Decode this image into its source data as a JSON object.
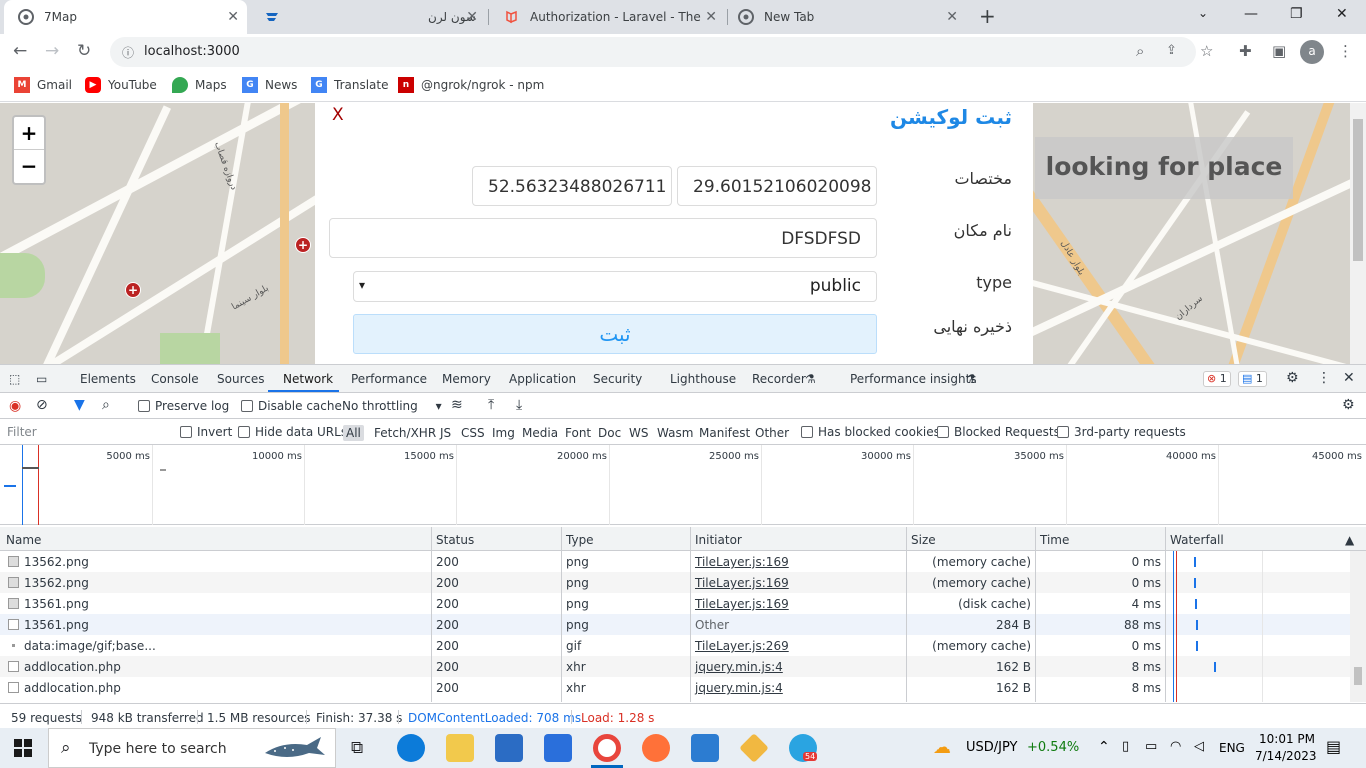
{
  "browser": {
    "tabs": [
      {
        "title": "7Map",
        "active": true
      },
      {
        "title": "سون لرن",
        "active": false
      },
      {
        "title": "Authorization - Laravel - The PHP",
        "active": false
      },
      {
        "title": "New Tab",
        "active": false
      }
    ],
    "url": "localhost:3000",
    "avatar_letter": "a",
    "bookmarks": [
      {
        "label": "Gmail",
        "color": "#ea4335",
        "icon": "gmail-icon"
      },
      {
        "label": "YouTube",
        "color": "#ff0000",
        "icon": "youtube-icon"
      },
      {
        "label": "Maps",
        "color": "#34a853",
        "icon": "maps-icon"
      },
      {
        "label": "News",
        "color": "#4285f4",
        "icon": "news-icon"
      },
      {
        "label": "Translate",
        "color": "#4285f4",
        "icon": "translate-icon"
      },
      {
        "label": "@ngrok/ngrok - npm",
        "color": "#cb0000",
        "icon": "npm-icon"
      }
    ]
  },
  "page": {
    "modal": {
      "close": "X",
      "title": "ثبت لوکیشن",
      "coords_label": "مختصات",
      "lat": "29.60152106020098",
      "lng": "52.56323488026711",
      "name_label": "نام مکان",
      "name_value": "DFSDFSD",
      "type_label": "type",
      "type_value": "public",
      "save_label": "ذخیره نهایی",
      "submit": "ثبت"
    },
    "search_overlay": "looking for place",
    "zoom_in": "+",
    "zoom_out": "−"
  },
  "devtools": {
    "tabs": [
      "Elements",
      "Console",
      "Sources",
      "Network",
      "Performance",
      "Memory",
      "Application",
      "Security",
      "Lighthouse",
      "Recorder",
      "Performance insights"
    ],
    "active_tab": "Network",
    "error_count": "1",
    "message_count": "1",
    "toolbar": {
      "preserve_log": "Preserve log",
      "disable_cache": "Disable cache",
      "throttling": "No throttling"
    },
    "filter": {
      "placeholder": "Filter",
      "invert": "Invert",
      "hide_data_urls": "Hide data URLs",
      "types": [
        "All",
        "Fetch/XHR",
        "JS",
        "CSS",
        "Img",
        "Media",
        "Font",
        "Doc",
        "WS",
        "Wasm",
        "Manifest",
        "Other"
      ],
      "has_blocked_cookies": "Has blocked cookies",
      "blocked_requests": "Blocked Requests",
      "third_party": "3rd-party requests"
    },
    "timeline_ticks": [
      "5000 ms",
      "10000 ms",
      "15000 ms",
      "20000 ms",
      "25000 ms",
      "30000 ms",
      "35000 ms",
      "40000 ms",
      "45000 ms"
    ],
    "columns": [
      "Name",
      "Status",
      "Type",
      "Initiator",
      "Size",
      "Time",
      "Waterfall"
    ],
    "rows": [
      {
        "name": "13562.png",
        "status": "200",
        "type": "png",
        "initiator": "TileLayer.js:169",
        "size": "(memory cache)",
        "time": "0 ms"
      },
      {
        "name": "13562.png",
        "status": "200",
        "type": "png",
        "initiator": "TileLayer.js:169",
        "size": "(memory cache)",
        "time": "0 ms"
      },
      {
        "name": "13561.png",
        "status": "200",
        "type": "png",
        "initiator": "TileLayer.js:169",
        "size": "(disk cache)",
        "time": "4 ms"
      },
      {
        "name": "13561.png",
        "status": "200",
        "type": "png",
        "initiator": "Other",
        "size": "284 B",
        "time": "88 ms"
      },
      {
        "name": "data:image/gif;base...",
        "status": "200",
        "type": "gif",
        "initiator": "TileLayer.js:269",
        "size": "(memory cache)",
        "time": "0 ms"
      },
      {
        "name": "addlocation.php",
        "status": "200",
        "type": "xhr",
        "initiator": "jquery.min.js:4",
        "size": "162 B",
        "time": "8 ms"
      },
      {
        "name": "addlocation.php",
        "status": "200",
        "type": "xhr",
        "initiator": "jquery.min.js:4",
        "size": "162 B",
        "time": "8 ms"
      }
    ],
    "status": {
      "requests": "59 requests",
      "transferred": "948 kB transferred",
      "resources": "1.5 MB resources",
      "finish": "Finish: 37.38 s",
      "dcl": "DOMContentLoaded: 708 ms",
      "load": "Load: 1.28 s"
    }
  },
  "taskbar": {
    "search_placeholder": "Type here to search",
    "ticker": "USD/JPY",
    "ticker_change": "+0.54%",
    "lang": "ENG",
    "time": "10:01 PM",
    "date": "7/14/2023",
    "telegram_badge": "54"
  }
}
